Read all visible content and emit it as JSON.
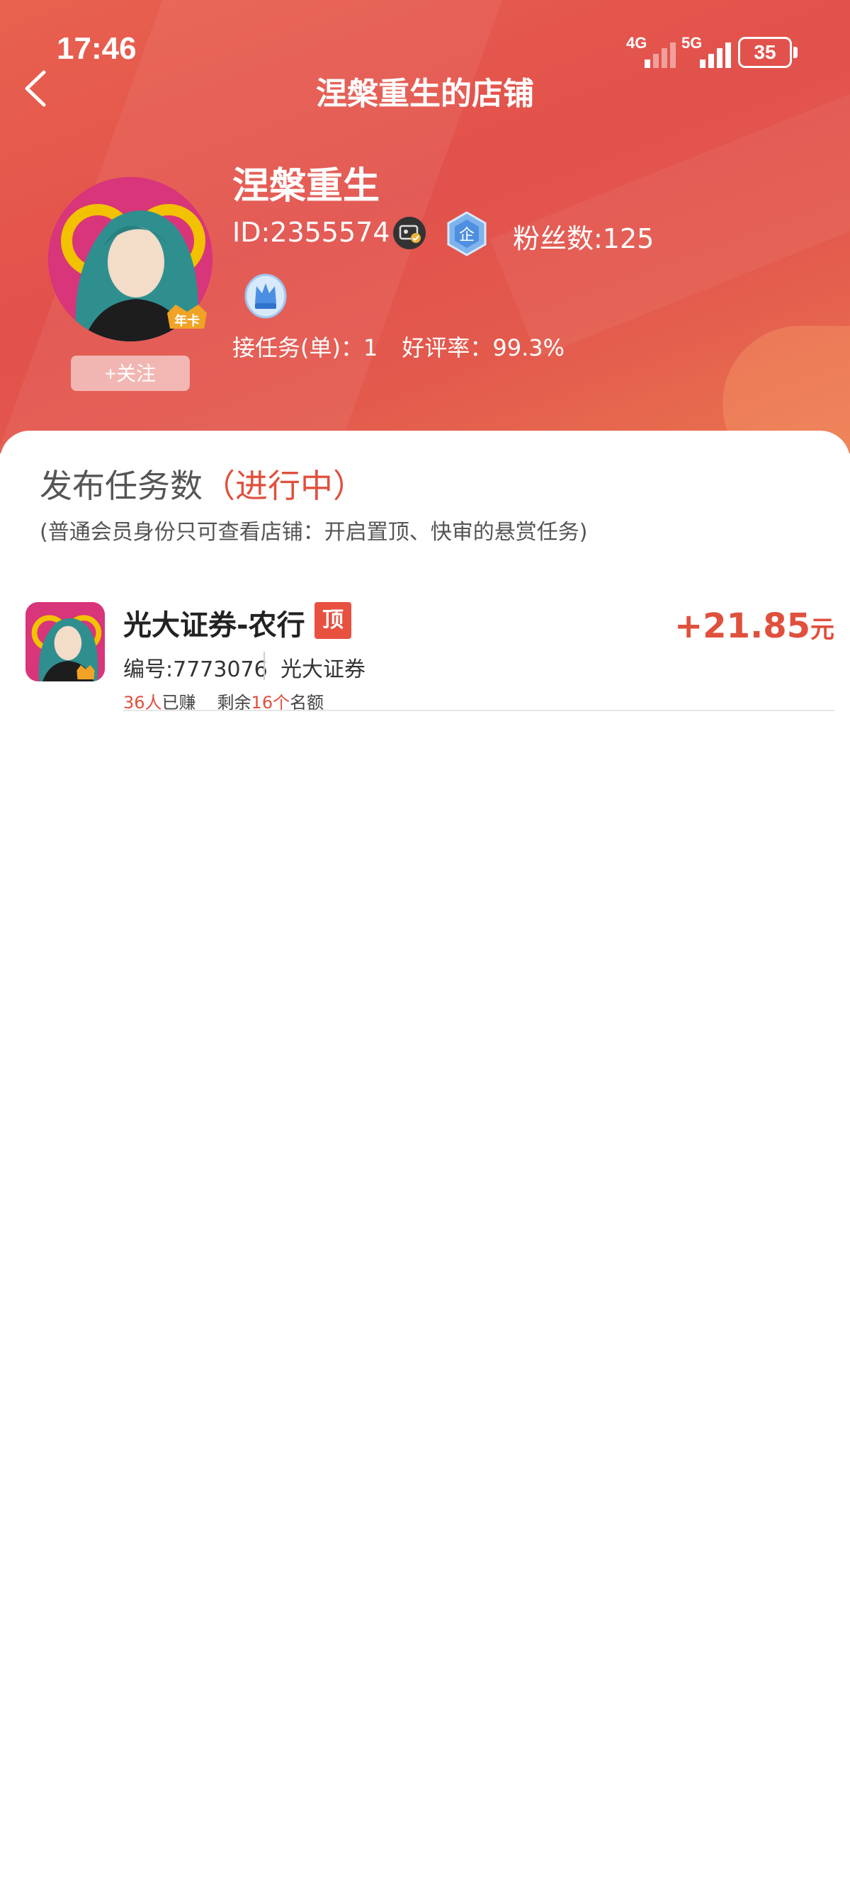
{
  "status_bar": {
    "time": "17:46",
    "net1": "4G",
    "net2": "5G",
    "battery": "35"
  },
  "header": {
    "title": "涅槃重生的店铺"
  },
  "profile": {
    "name": "涅槃重生",
    "id": "ID:2355574",
    "fans": "粉丝数:125",
    "qi_badge": "企",
    "year_badge": "年卡",
    "tasks_taken": "接任务(单)：1",
    "rating": "好评率：99.3%",
    "follow_label": "+关注"
  },
  "section": {
    "title": "发布任务数",
    "status": "（进行中）",
    "note": "(普通会员身份只可查看店铺：开启置顶、快审的悬赏任务)"
  },
  "tasks": [
    {
      "name": "光大证券-农行",
      "tag": "顶",
      "code": "编号:7773076",
      "category": "光大证券",
      "earned_count": "36人",
      "earned_label": "已赚",
      "remain_prefix": "剩余",
      "remain_count": "16个",
      "remain_suffix": "名额",
      "price": "+21.85",
      "unit": "元"
    }
  ],
  "colors": {
    "accent": "#e0503d",
    "header": "#e2514c"
  }
}
